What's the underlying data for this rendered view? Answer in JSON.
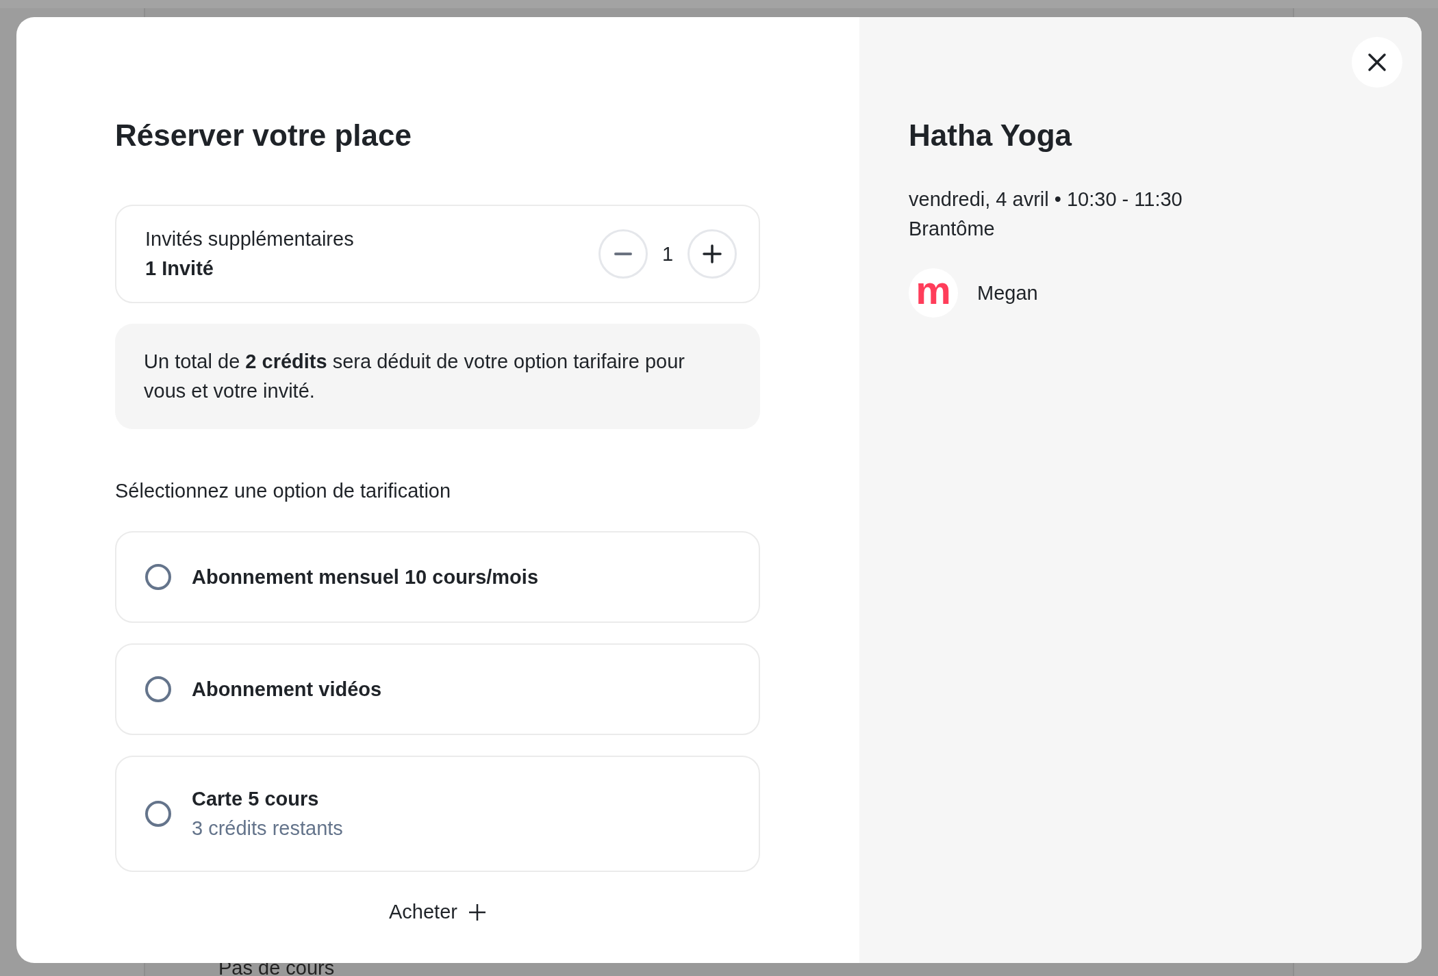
{
  "background": {
    "text": "Pas de cours"
  },
  "booking": {
    "title": "Réserver votre place",
    "guests": {
      "label": "Invités supplémentaires",
      "summary": "1 Invité",
      "value": "1"
    },
    "notice": "Un total de **2 crédits** sera déduit de votre option tarifaire pour vous et votre invité.",
    "pricing_label": "Sélectionnez une option de tarification",
    "pricing_options": [
      {
        "name": "Abonnement mensuel 10 cours/mois",
        "selected": false
      },
      {
        "name": "Abonnement vidéos",
        "selected": false
      },
      {
        "name": "Carte 5 cours",
        "detail": "3 crédits restants",
        "selected": false
      }
    ],
    "buy_button": "Acheter"
  },
  "class_info": {
    "title": "Hatha Yoga",
    "schedule": "vendredi, 4 avril • 10:30 - 11:30",
    "location": "Brantôme",
    "teacher": {
      "initial": "m",
      "name": "Megan"
    }
  }
}
